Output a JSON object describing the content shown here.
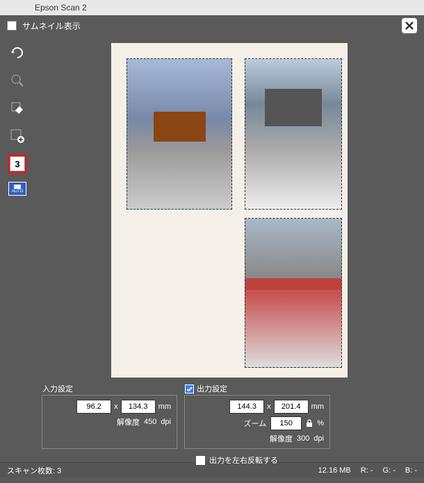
{
  "titlebar": {
    "app": "Epson Scan 2"
  },
  "header": {
    "thumbnail_label": "サムネイル表示"
  },
  "sidebar": {
    "marquee_count": "3",
    "auto_label": "AUTO"
  },
  "input_settings": {
    "title": "入力設定",
    "width": "96.2",
    "height": "134.3",
    "x": "x",
    "unit": "mm",
    "res_label": "解像度",
    "res_value": "450",
    "res_unit": "dpi"
  },
  "output_settings": {
    "title": "出力設定",
    "width": "144.3",
    "height": "201.4",
    "x": "x",
    "unit": "mm",
    "zoom_label": "ズーム",
    "zoom_value": "150",
    "zoom_unit": "%",
    "res_label": "解像度",
    "res_value": "300",
    "res_unit": "dpi"
  },
  "flip": {
    "label": "出力を左右反転する"
  },
  "status": {
    "scan_count_label": "スキャン枚数:",
    "scan_count": "3",
    "filesize": "12.16 MB",
    "r_label": "R:",
    "r_val": "-",
    "g_label": "G:",
    "g_val": "-",
    "b_label": "B:",
    "b_val": "-"
  }
}
